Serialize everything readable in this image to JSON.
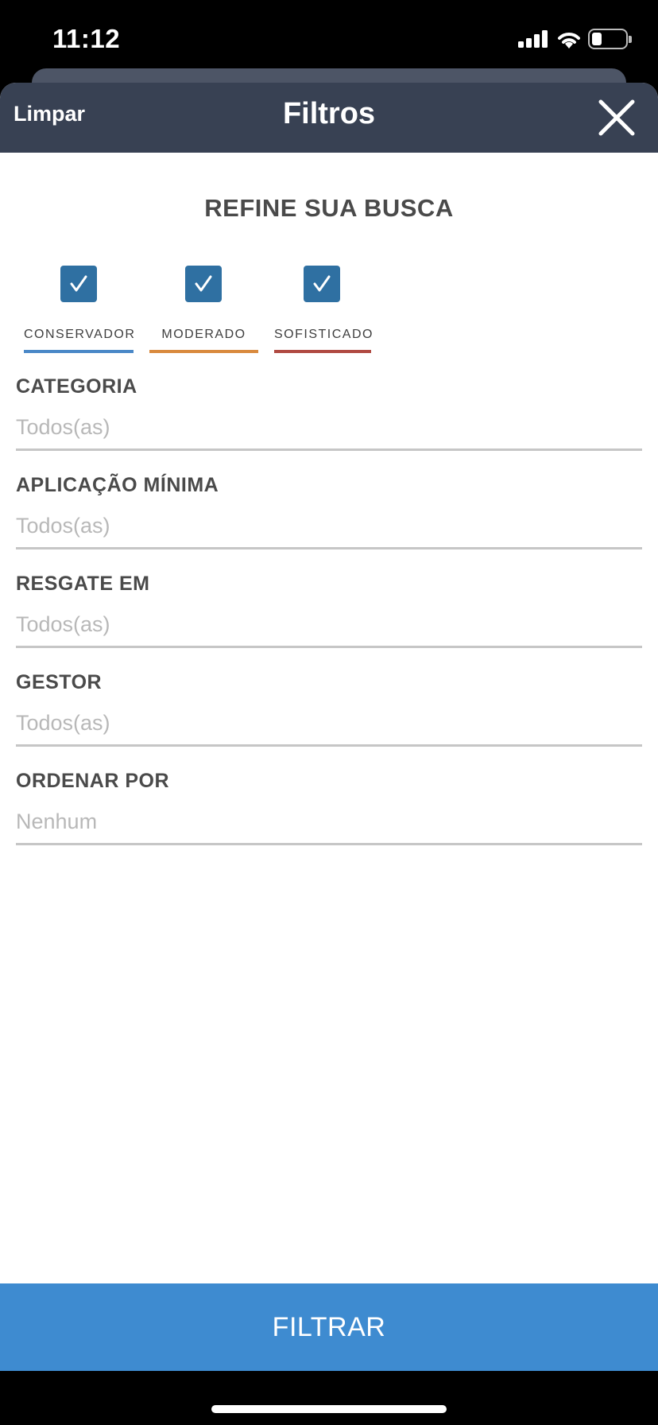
{
  "status_bar": {
    "time": "11:12"
  },
  "navbar": {
    "clear_label": "Limpar",
    "title": "Filtros"
  },
  "heading": "REFINE SUA BUSCA",
  "profiles": [
    {
      "label": "CONSERVADOR",
      "checked": true,
      "color": "#4a88c7"
    },
    {
      "label": "MODERADO",
      "checked": true,
      "color": "#d98a3e"
    },
    {
      "label": "SOFISTICADO",
      "checked": true,
      "color": "#b04a42"
    }
  ],
  "fields": [
    {
      "label": "CATEGORIA",
      "value": "Todos(as)"
    },
    {
      "label": "APLICAÇÃO MÍNIMA",
      "value": "Todos(as)"
    },
    {
      "label": "RESGATE EM",
      "value": "Todos(as)"
    },
    {
      "label": "GESTOR",
      "value": "Todos(as)"
    },
    {
      "label": "ORDENAR POR",
      "value": "Nenhum"
    }
  ],
  "filter_button": "FILTRAR",
  "colors": {
    "navbar": "#384153",
    "checkbox": "#2f70a2",
    "button": "#3e8bd0"
  }
}
